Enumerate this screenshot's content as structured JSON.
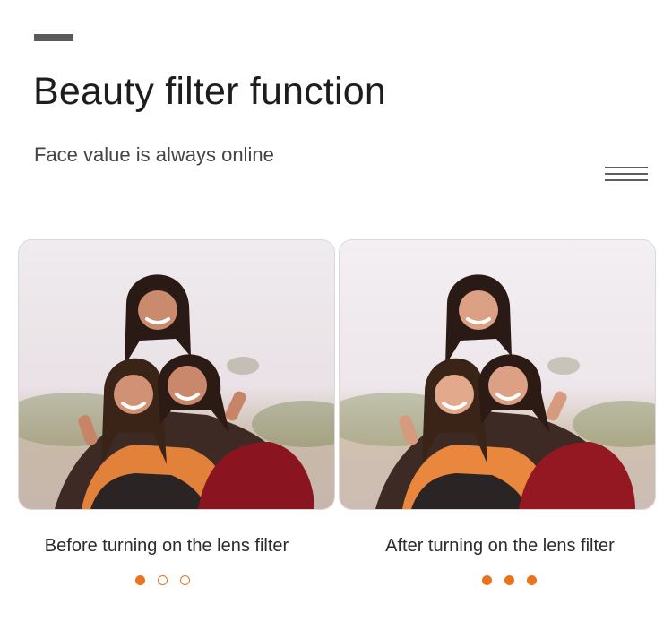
{
  "header": {
    "title": "Beauty filter function",
    "subtitle": "Face value is always online"
  },
  "comparison": {
    "before": {
      "caption": "Before turning on the lens filter",
      "active_dot": 0
    },
    "after": {
      "caption": "After turning on the lens filter",
      "active_dot": 2
    }
  },
  "icons": {
    "menu": "hamburger-menu-icon",
    "accent": "accent-bar"
  },
  "colors": {
    "accent": "#e8741f",
    "title": "#1d1d1d",
    "subtitle": "#444444"
  }
}
